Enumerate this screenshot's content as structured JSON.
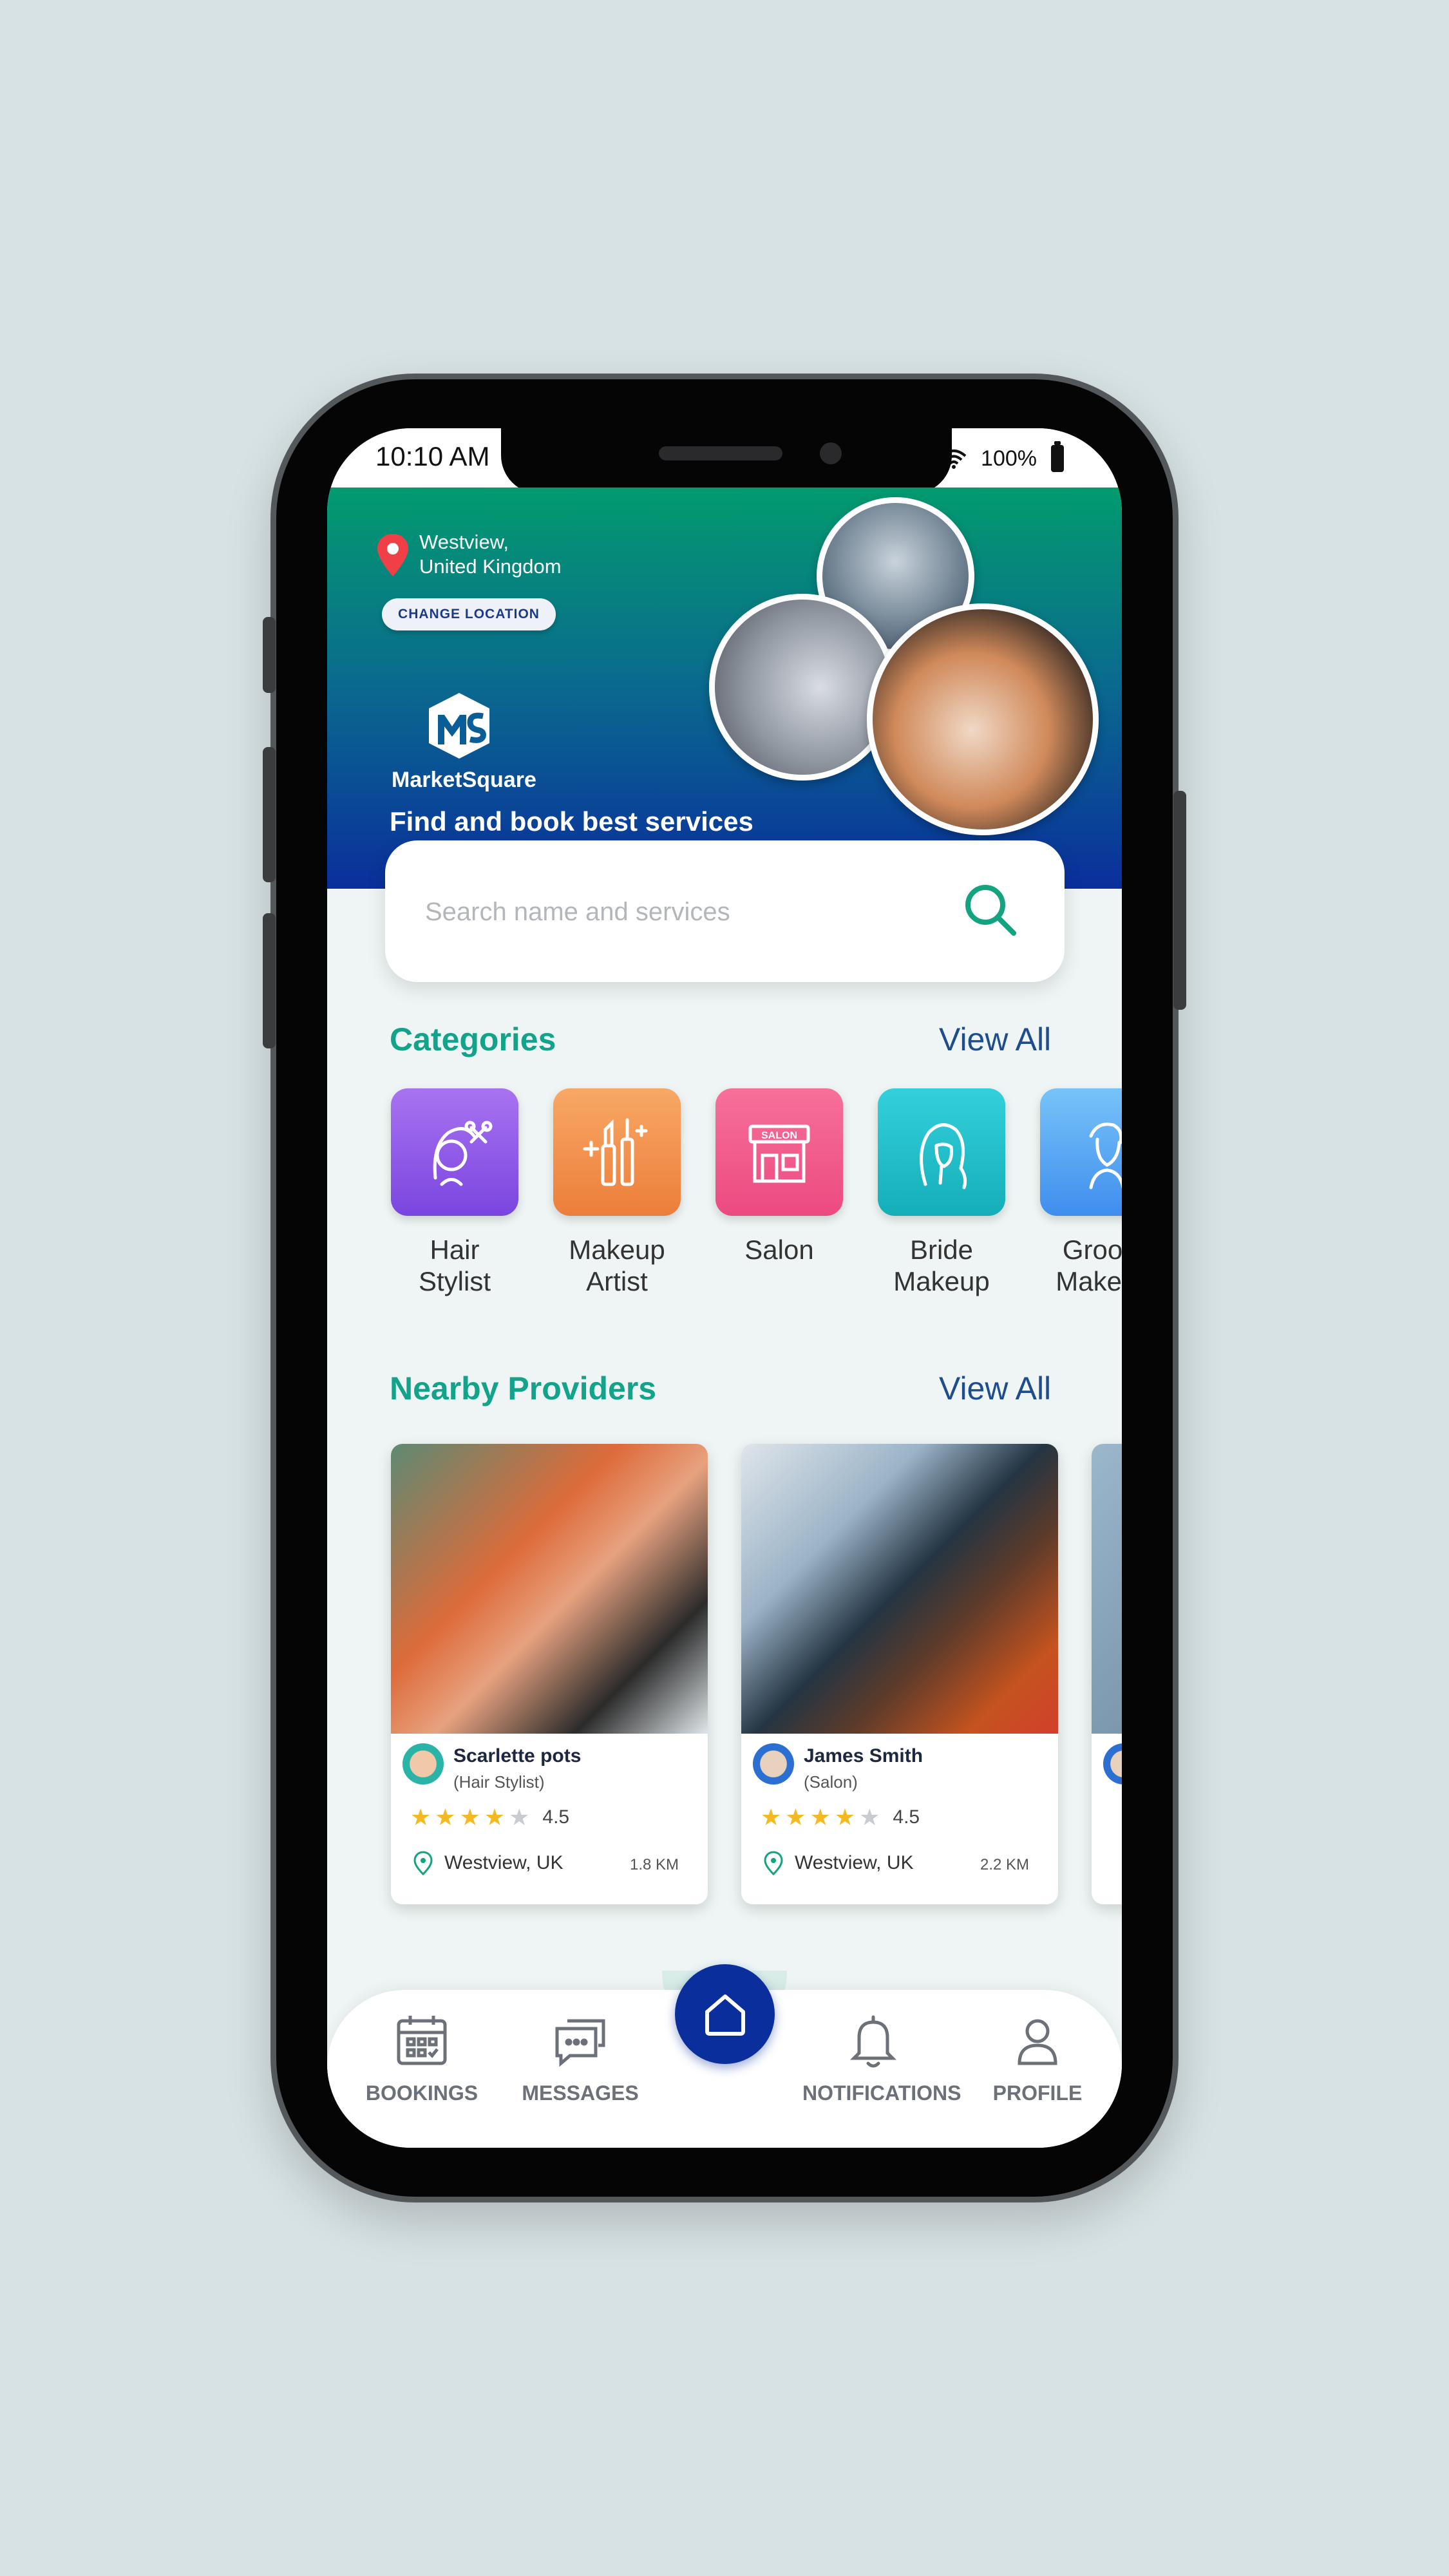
{
  "status_bar": {
    "time": "10:10 AM",
    "battery": "100%"
  },
  "header": {
    "location_line1": "Westview,",
    "location_line2": "United Kingdom",
    "change_location": "CHANGE LOCATION",
    "logo_name": "MarketSquare",
    "tagline": "Find and book best services"
  },
  "search": {
    "placeholder": "Search name and services"
  },
  "categories": {
    "title": "Categories",
    "view_all": "View All",
    "items": [
      {
        "line1": "Hair",
        "line2": "Stylist",
        "color_top": "#a873f0",
        "color_bottom": "#7a45e0",
        "icon": "hair-stylist-icon"
      },
      {
        "line1": "Makeup",
        "line2": "Artist",
        "color_top": "#f8a865",
        "color_bottom": "#ec7e3a",
        "icon": "makeup-icon"
      },
      {
        "line1": "Salon",
        "line2": "",
        "color_top": "#f7709a",
        "color_bottom": "#ec4a80",
        "icon": "salon-icon"
      },
      {
        "line1": "Bride",
        "line2": "Makeup",
        "color_top": "#33d0dc",
        "color_bottom": "#15aeb8",
        "icon": "bride-icon"
      },
      {
        "line1": "Groom",
        "line2": "Makeup",
        "color_top": "#78c3f8",
        "color_bottom": "#3f8eee",
        "icon": "groom-icon"
      }
    ]
  },
  "providers": {
    "title": "Nearby Providers",
    "view_all": "View All",
    "items": [
      {
        "name": "Scarlette pots",
        "role": "(Hair Stylist)",
        "rating": "4.5",
        "stars": 4,
        "location": "Westview, UK",
        "distance": "1.8 KM"
      },
      {
        "name": "James Smith",
        "role": "(Salon)",
        "rating": "4.5",
        "stars": 4,
        "location": "Westview, UK",
        "distance": "2.2 KM"
      }
    ]
  },
  "nav": {
    "bookings": "BOOKINGS",
    "messages": "MESSAGES",
    "notifications": "NOTIFICATIONS",
    "profile": "PROFILE"
  },
  "colors": {
    "accent_green": "#12a38a",
    "nav_blue": "#0a2f9c",
    "link_blue": "#1f4c8c"
  }
}
